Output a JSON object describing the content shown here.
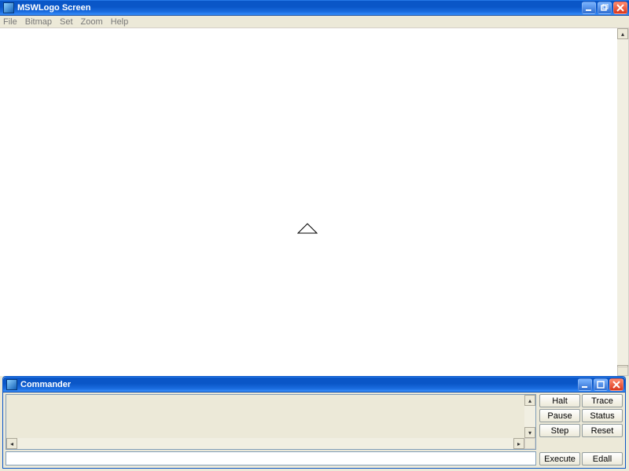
{
  "main_window": {
    "title": "MSWLogo Screen",
    "menus": [
      "File",
      "Bitmap",
      "Set",
      "Zoom",
      "Help"
    ]
  },
  "commander": {
    "title": "Commander",
    "history_text": "",
    "input_value": "",
    "buttons": {
      "halt": "Halt",
      "trace": "Trace",
      "pause": "Pause",
      "status": "Status",
      "step": "Step",
      "reset": "Reset",
      "execute": "Execute",
      "edall": "Edall"
    }
  }
}
